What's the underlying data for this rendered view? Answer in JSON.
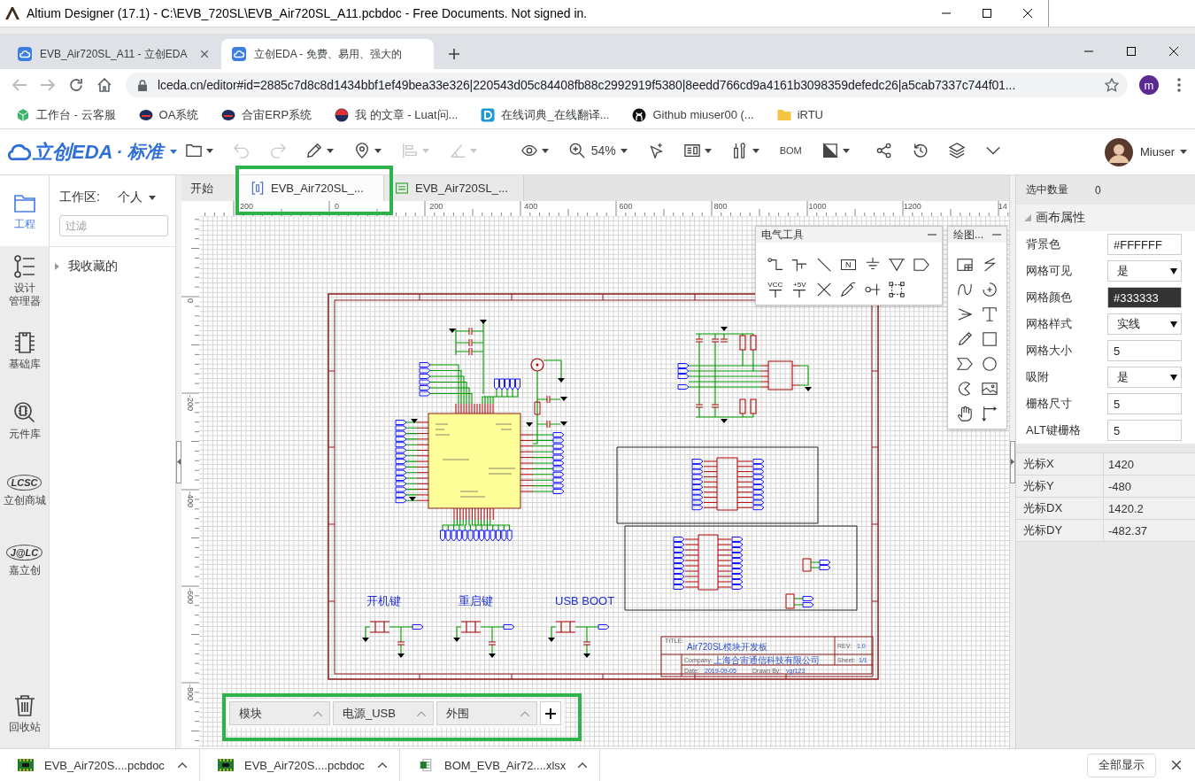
{
  "background_window": {
    "title": "Altium Designer (17.1) - C:\\EVB_720SL\\EVB_Air720SL_A11.pcbdoc - Free Documents. Not signed in."
  },
  "browser": {
    "tabs": [
      {
        "label": "EVB_Air720SL_A11 - 立创EDA",
        "selected": false,
        "close_button": true
      },
      {
        "label": "立创EDA - 免费、易用、强大的",
        "selected": true,
        "close_button": false
      }
    ],
    "back_disabled": true,
    "forward_disabled": true,
    "url": "lceda.cn/editor#id=2885c7d8c8d1434bbf1ef49bea33e326|220543d05c84408fb88c2992919f5380|8eedd766cd9a4161b3098359defedc26|a5cab7337c744f01...",
    "profile_letter": "m",
    "bookmarks": [
      {
        "label": "工作台 - 云客服",
        "kind": "site"
      },
      {
        "label": "OA系统",
        "kind": "site"
      },
      {
        "label": "合宙ERP系统",
        "kind": "site"
      },
      {
        "label": "我 的文章 - Luat问...",
        "kind": "site"
      },
      {
        "label": "在线词典_在线翻译...",
        "kind": "site"
      },
      {
        "label": "Github miuser00 (...",
        "kind": "site"
      },
      {
        "label": "iRTU",
        "kind": "folder"
      }
    ]
  },
  "toolbar": {
    "logo": "立创EDA",
    "edition": "· 标准",
    "groups": [
      [
        {
          "kind": "icon",
          "dropdown": true,
          "disabled": false
        },
        {
          "kind": "icon",
          "dropdown": false,
          "disabled": true
        },
        {
          "kind": "icon",
          "dropdown": false,
          "disabled": true
        },
        {
          "kind": "icon",
          "dropdown": true,
          "disabled": false
        },
        {
          "kind": "icon",
          "dropdown": true,
          "disabled": false
        },
        {
          "kind": "icon",
          "dropdown": true,
          "disabled": true
        },
        {
          "kind": "icon",
          "dropdown": true,
          "disabled": true
        }
      ],
      [
        {
          "kind": "icon",
          "dropdown": true,
          "disabled": false
        },
        {
          "kind": "zoom",
          "label": "54%",
          "dropdown": true,
          "disabled": false
        },
        {
          "kind": "icon",
          "dropdown": false,
          "disabled": false
        },
        {
          "kind": "icon",
          "dropdown": true,
          "disabled": false
        },
        {
          "kind": "icon",
          "dropdown": true,
          "disabled": false
        },
        {
          "kind": "text",
          "label": "BOM",
          "dropdown": false,
          "disabled": false
        },
        {
          "kind": "icon",
          "dropdown": true,
          "disabled": false
        }
      ],
      [
        {
          "kind": "icon",
          "dropdown": false,
          "disabled": false
        },
        {
          "kind": "icon",
          "dropdown": false,
          "disabled": false
        },
        {
          "kind": "icon",
          "dropdown": false,
          "disabled": false
        },
        {
          "kind": "icon",
          "dropdown": false,
          "disabled": false
        }
      ]
    ],
    "user": "Miuser"
  },
  "rail": {
    "items": [
      {
        "label": "工程",
        "kind": "icon",
        "selected": true
      },
      {
        "label": "设计管理器",
        "kind": "icon",
        "selected": false
      },
      {
        "label": "基础库",
        "kind": "icon",
        "selected": false
      },
      {
        "label": "元件库",
        "kind": "icon",
        "selected": false
      },
      {
        "label": "立创商城",
        "kind": "logo",
        "logo": "LCSC",
        "selected": false
      },
      {
        "label": "嘉立创",
        "kind": "logo",
        "logo": "J@LC",
        "selected": false
      }
    ],
    "trash": "回收站"
  },
  "project_panel": {
    "workspace_label": "工作区:",
    "workspace": "个人",
    "filter": {
      "placeholder": "过滤"
    },
    "tree": [
      {
        "label": "我收藏的",
        "expanded": false
      }
    ]
  },
  "document_tabs": [
    {
      "label": "开始",
      "kind": "start",
      "selected": false
    },
    {
      "label": "EVB_Air720SL_...",
      "kind": "schematic",
      "selected": true
    },
    {
      "label": "EVB_Air720SL_...",
      "kind": "pcb",
      "selected": false
    }
  ],
  "rulers": {
    "horizontal": [
      "200",
      "0",
      "200",
      "400",
      "600",
      "800",
      "1000",
      "1200",
      "14"
    ],
    "vertical": [
      "0",
      "-200",
      "-400",
      "-600",
      "-800"
    ]
  },
  "schematic": {
    "section_labels": [
      "开机键",
      "重启键",
      "USB BOOT"
    ],
    "title_block": {
      "title_label": "TITLE:",
      "title": "Air720SL模块开发板",
      "rev_label": "REV:",
      "rev": "1.0",
      "company_label": "Company:",
      "company": "上海合宙通信科技有限公司",
      "sheet_label": "Sheet:",
      "sheet": "1/1",
      "date_label": "Date:",
      "date": "2019-09-05",
      "drawn_by_label": "Drawn By:",
      "drawn_by": "vgr123"
    }
  },
  "electrical_tools": {
    "title": "电气工具",
    "tools": [
      {
        "kind": "icon"
      },
      {
        "kind": "icon"
      },
      {
        "kind": "icon"
      },
      {
        "kind": "netlabel",
        "label": "N"
      },
      {
        "kind": "icon"
      },
      {
        "kind": "icon"
      },
      {
        "kind": "icon"
      },
      {
        "kind": "power",
        "label": "VCC"
      },
      {
        "kind": "power",
        "label": "+5V"
      },
      {
        "kind": "icon"
      },
      {
        "kind": "icon"
      },
      {
        "kind": "icon"
      },
      {
        "kind": "icon"
      }
    ]
  },
  "drawing_tools": {
    "title": "绘图..."
  },
  "sheet_tabs": [
    {
      "label": "模块"
    },
    {
      "label": "电源_USB"
    },
    {
      "label": "外围"
    }
  ],
  "properties": {
    "selected_count_label": "选中数量",
    "selected_count": "0",
    "section": {
      "title": "画布属性",
      "expanded": true
    },
    "rows": [
      {
        "label": "背景色",
        "kind": "color",
        "value": "#FFFFFF"
      },
      {
        "label": "网格可见",
        "kind": "select",
        "value": "是"
      },
      {
        "label": "网格颜色",
        "kind": "color",
        "value": "#333333"
      },
      {
        "label": "网格样式",
        "kind": "select",
        "value": "实线"
      },
      {
        "label": "网格大小",
        "kind": "input",
        "value": "5"
      },
      {
        "label": "吸附",
        "kind": "select",
        "value": "是"
      },
      {
        "label": "栅格尺寸",
        "kind": "input",
        "value": "5"
      },
      {
        "label": "ALT键栅格",
        "kind": "input",
        "value": "5"
      }
    ],
    "cursor": [
      {
        "label": "光标X",
        "value": "1420"
      },
      {
        "label": "光标Y",
        "value": "-480"
      },
      {
        "label": "光标DX",
        "value": "1420.2"
      },
      {
        "label": "光标DY",
        "value": "-482.37"
      }
    ]
  },
  "downloads": {
    "items": [
      {
        "name": "EVB_Air720S....pcbdoc",
        "kind": "pcb"
      },
      {
        "name": "EVB_Air720S....pcbdoc",
        "kind": "pcb"
      },
      {
        "name": "BOM_EVB_Air72....xlsx",
        "kind": "sheet"
      }
    ],
    "show_all": "全部显示"
  }
}
